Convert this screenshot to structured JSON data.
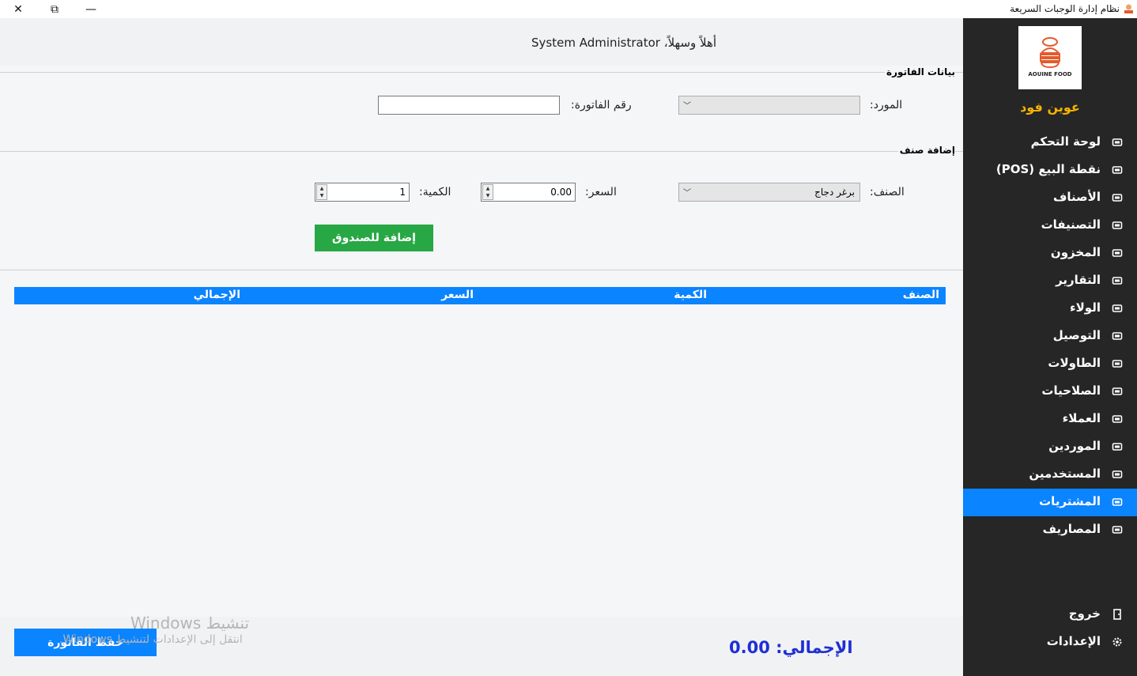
{
  "window": {
    "title": "نظام إدارة الوجبات السريعة",
    "close_glyph": "✕",
    "max_glyph": "⧉",
    "min_glyph": "—"
  },
  "header": {
    "welcome": "أهلاً وسهلاً، System Administrator"
  },
  "invoice_section": {
    "title": "بيانات الفاتورة",
    "supplier_label": "المورد:",
    "supplier_value": "",
    "invoice_number_label": "رقم الفاتورة:",
    "invoice_number_value": ""
  },
  "add_item_section": {
    "title": "إضافة صنف",
    "item_label": "الصنف:",
    "item_value": "برغر دجاج",
    "price_label": "السعر:",
    "price_value": "0.00",
    "qty_label": "الكمية:",
    "qty_value": "1",
    "add_button": "إضافة للصندوق"
  },
  "grid": {
    "columns": [
      "الصنف",
      "الكمية",
      "السعر",
      "الإجمالي"
    ],
    "rows": []
  },
  "footer": {
    "save_button": "حفظ الفاتورة",
    "total_label": "الإجمالي: 0.00",
    "watermark_title": "تنشيط Windows",
    "watermark_sub": "انتقل إلى الإعدادات لتنشيط Windows."
  },
  "sidebar": {
    "logo_text": "AOUINE FOOD",
    "brand": "عوين فود",
    "items": [
      {
        "label": "لوحة التحكم",
        "icon": "home-icon"
      },
      {
        "label": "نقطة البيع (POS)",
        "icon": "cash-register-icon"
      },
      {
        "label": "الأصناف",
        "icon": "burger-icon"
      },
      {
        "label": "التصنيفات",
        "icon": "folder-icon"
      },
      {
        "label": "المخزون",
        "icon": "box-icon"
      },
      {
        "label": "التقارير",
        "icon": "chart-icon"
      },
      {
        "label": "الولاء",
        "icon": "gem-icon"
      },
      {
        "label": "التوصيل",
        "icon": "truck-icon"
      },
      {
        "label": "الطاولات",
        "icon": "table-icon"
      },
      {
        "label": "الصلاحيات",
        "icon": "lock-icon"
      },
      {
        "label": "العملاء",
        "icon": "user-icon"
      },
      {
        "label": "الموردين",
        "icon": "truck-icon"
      },
      {
        "label": "المستخدمين",
        "icon": "users-icon"
      },
      {
        "label": "المشتريات",
        "icon": "cart-icon"
      },
      {
        "label": "المصاريف",
        "icon": "money-icon"
      }
    ],
    "active_index": 13,
    "logout": {
      "label": "خروج",
      "icon": "door-icon"
    },
    "settings": {
      "label": "الإعدادات",
      "icon": "gear-icon"
    },
    "accent_color": "#0a84ff",
    "brand_color": "#f5b400"
  }
}
